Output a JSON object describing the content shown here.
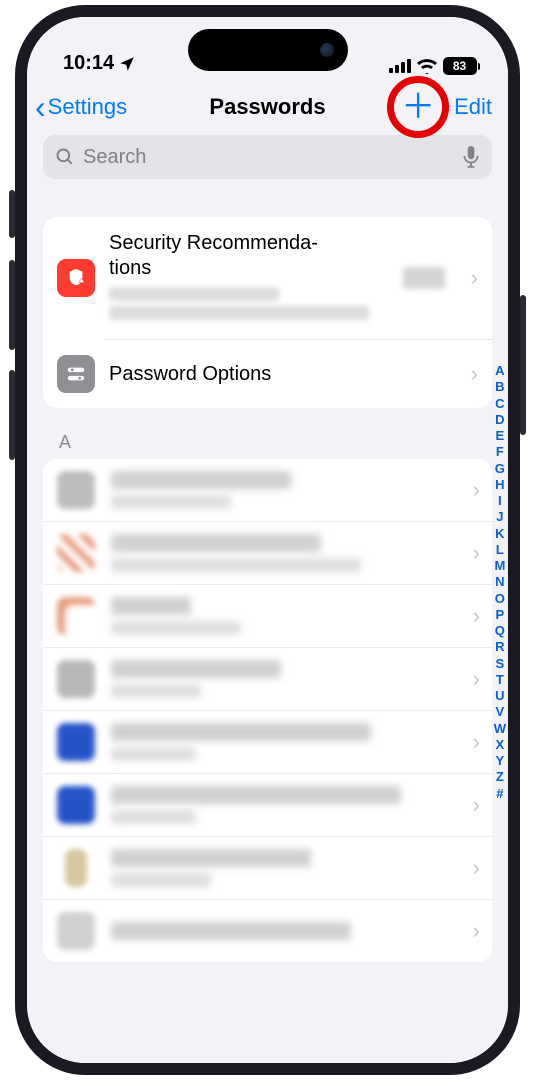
{
  "status": {
    "time": "10:14",
    "battery": "83"
  },
  "nav": {
    "back_label": "Settings",
    "title": "Passwords",
    "edit_label": "Edit"
  },
  "search": {
    "placeholder": "Search",
    "value": ""
  },
  "top_section": {
    "security": {
      "title": "Security Recommenda-\ntions"
    },
    "options": {
      "title": "Password Options"
    }
  },
  "sections": [
    {
      "letter": "A",
      "items": [
        {
          "favicon_color": "#bdbdbd",
          "w1": 180,
          "w2": 120
        },
        {
          "favicon_color": "#e8a080",
          "w1": 210,
          "w2": 250,
          "favicon_pattern": true
        },
        {
          "favicon_color": "#ffffff",
          "w1": 80,
          "w2": 130,
          "favicon_small_orange": true
        },
        {
          "favicon_color": "#b8b8b8",
          "w1": 170,
          "w2": 90
        },
        {
          "favicon_color": "#2653c8",
          "w1": 260,
          "w2": 85
        },
        {
          "favicon_color": "#2653c8",
          "w1": 290,
          "w2": 85
        },
        {
          "favicon_color": "#d7c79f",
          "w1": 200,
          "w2": 100,
          "favicon_narrow": true
        },
        {
          "favicon_color": "#d0d0d0",
          "w1": 240,
          "w2": 0,
          "short": true
        }
      ]
    }
  ],
  "index_letters": [
    "A",
    "B",
    "C",
    "D",
    "E",
    "F",
    "G",
    "H",
    "I",
    "J",
    "K",
    "L",
    "M",
    "N",
    "O",
    "P",
    "Q",
    "R",
    "S",
    "T",
    "U",
    "V",
    "W",
    "X",
    "Y",
    "Z",
    "#"
  ]
}
